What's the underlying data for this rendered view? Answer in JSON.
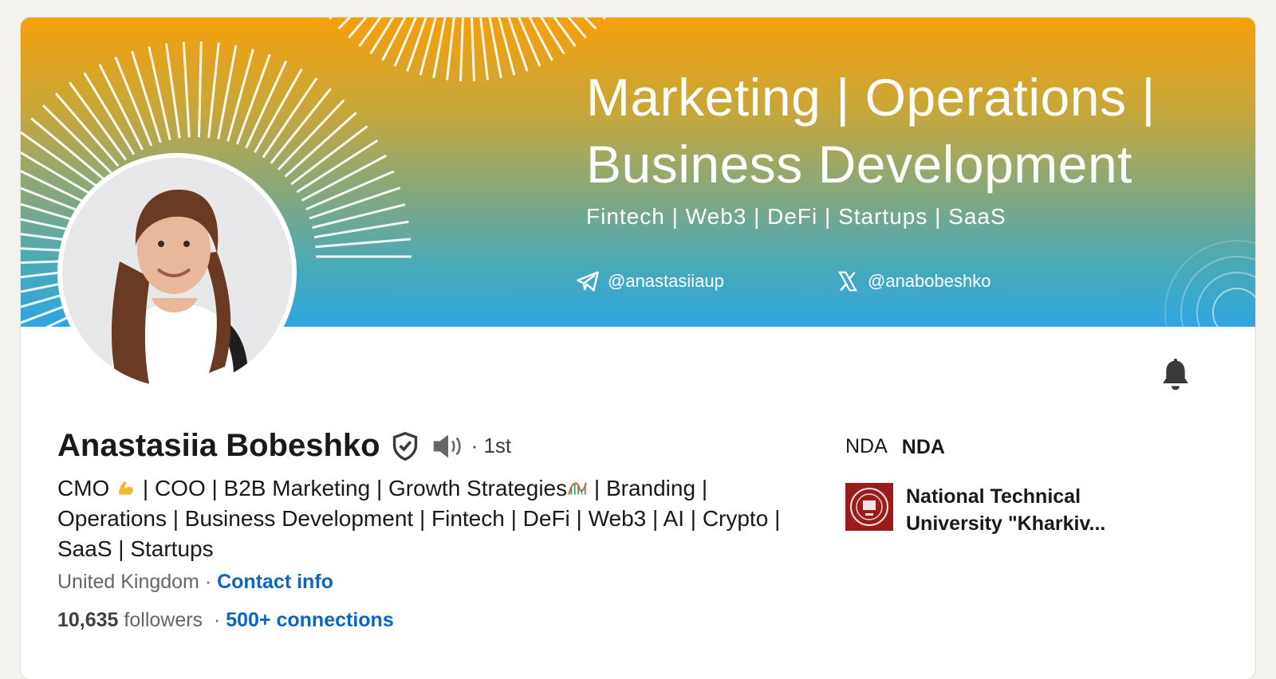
{
  "banner": {
    "title_line1": "Marketing | Operations |",
    "title_line2": "Business Development",
    "subtitle": "Fintech | Web3 | DeFi | Startups | SaaS",
    "telegram_handle": "@anastasiiaup",
    "x_handle": "@anabobeshko"
  },
  "profile": {
    "name": "Anastasiia Bobeshko",
    "degree": "· 1st",
    "headline_part1": "CMO ",
    "headline_part2": " | COO | B2B Marketing | Growth Strategies",
    "headline_part3": " | Branding | Operations | Business Development | Fintech | DeFi | Web3 | AI | Crypto | SaaS | Startups",
    "location": "United Kingdom",
    "location_sep": " · ",
    "contact_info": "Contact info",
    "followers_count": "10,635",
    "followers_label": " followers",
    "connections_sep": "  · ",
    "connections": "500+ connections"
  },
  "sidebar": {
    "company_prefix": "NDA",
    "company_name": "NDA",
    "school_name_line1": "National Technical",
    "school_name_line2": "University \"Kharkiv..."
  },
  "colors": {
    "link": "#0a66c2",
    "banner_top": "#f59f0b",
    "banner_bottom": "#2ea6e0",
    "school_logo": "#9c1c1c"
  },
  "icons": [
    "verified-shield-icon",
    "speaker-icon",
    "bell-icon",
    "telegram-icon",
    "x-logo-icon",
    "flexed-biceps-emoji",
    "roller-coaster-emoji"
  ]
}
